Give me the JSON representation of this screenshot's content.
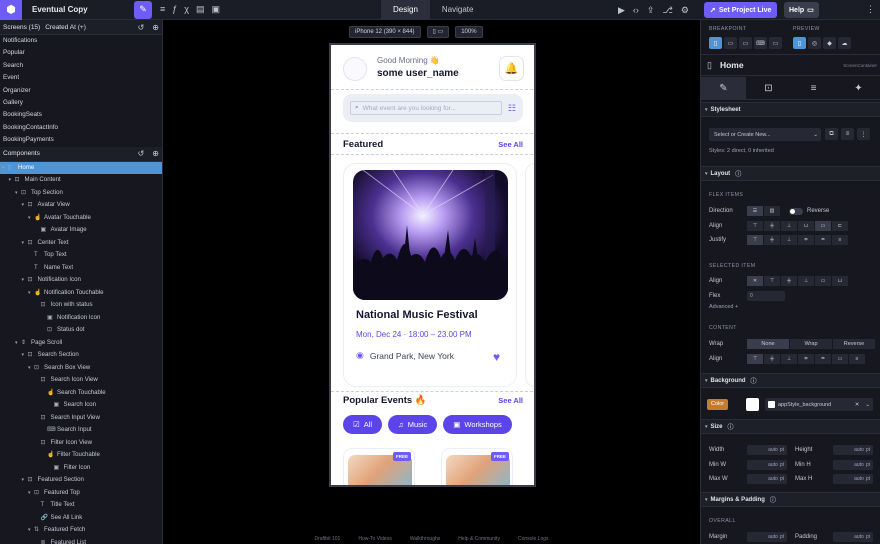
{
  "topbar": {
    "project_name": "Eventual Copy",
    "tabs": [
      "Design",
      "Navigate"
    ],
    "set_live_label": "Set Project Live",
    "help_label": "Help"
  },
  "left": {
    "screens_title": "Screens (15)",
    "screens_sort": "Created At (+)",
    "screens": [
      "Notifications",
      "Popular",
      "Search",
      "Event",
      "Organizer",
      "Gallery",
      "BookingSeats",
      "BookingContactInfo",
      "BookingPayments"
    ],
    "components_title": "Components",
    "tree": [
      {
        "label": "Home",
        "depth": 0,
        "icon": "screen",
        "selected": true
      },
      {
        "label": "Main Content",
        "depth": 1,
        "icon": "view"
      },
      {
        "label": "Top Section",
        "depth": 2,
        "icon": "view"
      },
      {
        "label": "Avatar View",
        "depth": 3,
        "icon": "view"
      },
      {
        "label": "Avatar Touchable",
        "depth": 4,
        "icon": "touch"
      },
      {
        "label": "Avatar Image",
        "depth": 5,
        "icon": "image"
      },
      {
        "label": "Center Text",
        "depth": 3,
        "icon": "view"
      },
      {
        "label": "Top Text",
        "depth": 4,
        "icon": "text"
      },
      {
        "label": "Name Text",
        "depth": 4,
        "icon": "text"
      },
      {
        "label": "Notification Icon",
        "depth": 3,
        "icon": "view"
      },
      {
        "label": "Notification Touchable",
        "depth": 4,
        "icon": "touch"
      },
      {
        "label": "Icon with status",
        "depth": 5,
        "icon": "view"
      },
      {
        "label": "Notification Icon",
        "depth": 6,
        "icon": "image"
      },
      {
        "label": "Status dot",
        "depth": 6,
        "icon": "view"
      },
      {
        "label": "Page Scroll",
        "depth": 2,
        "icon": "scroll"
      },
      {
        "label": "Search Section",
        "depth": 3,
        "icon": "view"
      },
      {
        "label": "Search Box View",
        "depth": 4,
        "icon": "view"
      },
      {
        "label": "Search Icon View",
        "depth": 5,
        "icon": "view"
      },
      {
        "label": "Search Touchable",
        "depth": 6,
        "icon": "touch"
      },
      {
        "label": "Search Icon",
        "depth": 7,
        "icon": "image"
      },
      {
        "label": "Search Input View",
        "depth": 5,
        "icon": "view"
      },
      {
        "label": "Search Input",
        "depth": 6,
        "icon": "input"
      },
      {
        "label": "Filter Icon View",
        "depth": 5,
        "icon": "view"
      },
      {
        "label": "Filter Touchable",
        "depth": 6,
        "icon": "touch"
      },
      {
        "label": "Filter Icon",
        "depth": 7,
        "icon": "image"
      },
      {
        "label": "Featured Section",
        "depth": 3,
        "icon": "view"
      },
      {
        "label": "Featured Top",
        "depth": 4,
        "icon": "view"
      },
      {
        "label": "Title Text",
        "depth": 5,
        "icon": "text"
      },
      {
        "label": "See All Link",
        "depth": 5,
        "icon": "link"
      },
      {
        "label": "Featured Fetch",
        "depth": 4,
        "icon": "fetch"
      },
      {
        "label": "Featured List",
        "depth": 5,
        "icon": "list"
      }
    ]
  },
  "canvas": {
    "device": "iPhone 12 (390 × 844)",
    "zoom": "100%",
    "footer_links": [
      "Draftbit 101",
      "How-To Videos",
      "Walkthroughs",
      "Help & Community",
      "Console Logs"
    ]
  },
  "phone": {
    "greeting": "Good Morning 👋",
    "username": "some user_name",
    "search_placeholder": "What event are you looking for...",
    "featured_title": "Featured",
    "see_all": "See All",
    "event_title": "National Music Festival",
    "event_date": "Mon, Dec 24 · 18:00 – 23.00 PM",
    "event_location": "Grand Park, New York",
    "popular_title": "Popular Events 🔥",
    "popular_see_all": "See All",
    "pills": [
      "All",
      "Music",
      "Workshops"
    ],
    "free_badge": "FREE"
  },
  "right": {
    "breakpoint_label": "BREAKPOINT",
    "preview_label": "PREVIEW",
    "home_title": "Home",
    "home_type": "ScreenContainer",
    "stylesheet_section": "Stylesheet",
    "stylesheet_select": "Select or Create New...",
    "styles_info": "Styles: 2 direct, 0 inherited",
    "layout_section": "Layout",
    "flex_items": "FLEX ITEMS",
    "direction": "Direction",
    "reverse": "Reverse",
    "align": "Align",
    "justify": "Justify",
    "selected_item": "SELECTED ITEM",
    "flex": "Flex",
    "flex_value": "0",
    "advanced": "Advanced +",
    "content": "CONTENT",
    "wrap": "Wrap",
    "wrap_options": [
      "None",
      "Wrap",
      "Reverse"
    ],
    "background_section": "Background",
    "color_chip": "Color",
    "bg_value": "appStyle_background",
    "size_section": "Size",
    "size_rows": [
      [
        "Width",
        "auto",
        "Height",
        "auto"
      ],
      [
        "Min W",
        "auto",
        "Min H",
        "auto"
      ],
      [
        "Max W",
        "auto",
        "Max H",
        "auto"
      ]
    ],
    "unit": "pt",
    "margins_section": "Margins & Padding",
    "overall": "OVERALL",
    "margin": "Margin",
    "padding": "Padding",
    "margin_value": "auto",
    "padding_value": "auto"
  }
}
